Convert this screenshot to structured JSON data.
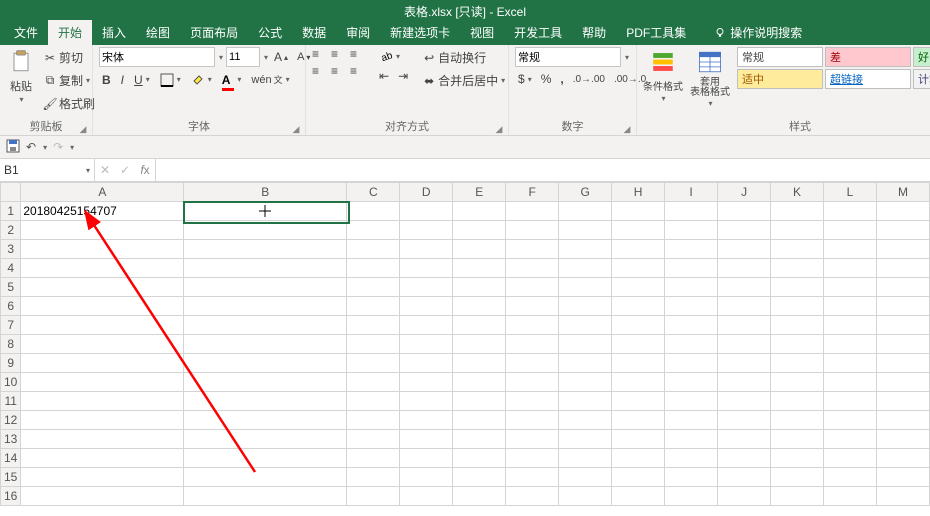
{
  "title": "表格.xlsx [只读] - Excel",
  "tabs": {
    "file": "文件",
    "home": "开始",
    "insert": "插入",
    "draw": "绘图",
    "layout": "页面布局",
    "formulas": "公式",
    "data": "数据",
    "review": "审阅",
    "newtab": "新建选项卡",
    "view": "视图",
    "dev": "开发工具",
    "help": "帮助",
    "pdf": "PDF工具集",
    "tell": "操作说明搜索"
  },
  "clipboard": {
    "paste": "粘贴",
    "cut": "剪切",
    "copy": "复制",
    "formatpainter": "格式刷",
    "group": "剪贴板"
  },
  "font": {
    "name": "宋体",
    "size": "11",
    "group": "字体"
  },
  "align": {
    "wrap": "自动换行",
    "merge": "合并后居中",
    "group": "对齐方式"
  },
  "number": {
    "format": "常规",
    "group": "数字"
  },
  "styles": {
    "condfmt": "条件格式",
    "astable": "套用\n表格格式",
    "normal": "常规",
    "bad": "差",
    "good": "好",
    "neutral": "适中",
    "link": "超链接",
    "calc": "计算",
    "group": "样式"
  },
  "namebox": "B1",
  "cells": {
    "A1": "20180425154707"
  },
  "columns": [
    "A",
    "B",
    "C",
    "D",
    "E",
    "F",
    "G",
    "H",
    "I",
    "J",
    "K",
    "L",
    "M"
  ],
  "rows": [
    "1",
    "2",
    "3",
    "4",
    "5",
    "6",
    "7",
    "8",
    "9",
    "10",
    "11",
    "12",
    "13",
    "14",
    "15",
    "16"
  ]
}
